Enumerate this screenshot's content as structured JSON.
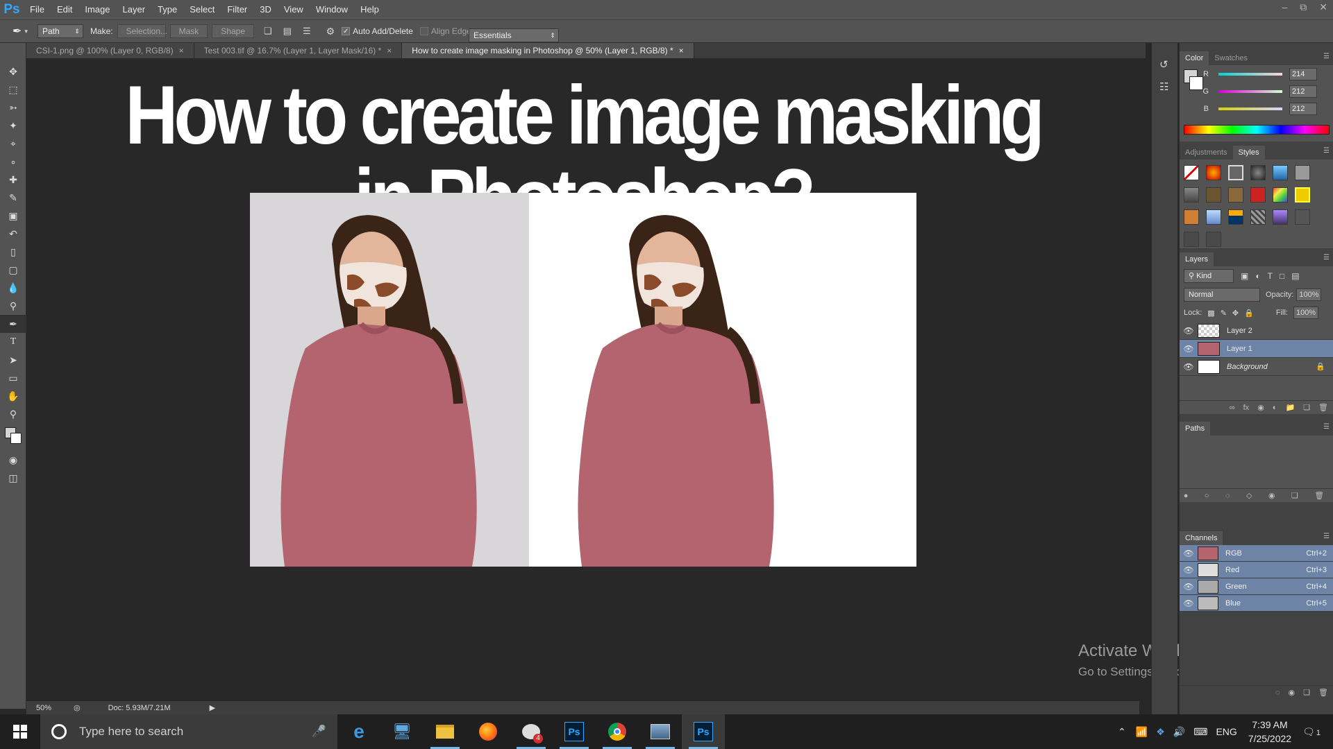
{
  "app": {
    "logo": "Ps"
  },
  "menu": [
    "File",
    "Edit",
    "Image",
    "Layer",
    "Type",
    "Select",
    "Filter",
    "3D",
    "View",
    "Window",
    "Help"
  ],
  "options": {
    "mode": "Path",
    "make_label": "Make:",
    "selection": "Selection...",
    "mask": "Mask",
    "shape": "Shape",
    "auto_add": "Auto Add/Delete",
    "align_edges": "Align Edges",
    "workspace": "Essentials"
  },
  "tabs": [
    {
      "label": "CSI-1.png @ 100% (Layer 0, RGB/8)",
      "close": "×"
    },
    {
      "label": "Test 003.tif @ 16.7% (Layer 1, Layer Mask/16) *",
      "close": "×"
    },
    {
      "label": "How to create image masking in Photoshop @ 50% (Layer 1, RGB/8) *",
      "close": "×"
    }
  ],
  "canvas": {
    "headline": "How to create image masking in Photoshop?"
  },
  "status": {
    "zoom": "50%",
    "doc": "Doc: 5.93M/7.21M"
  },
  "color_panel": {
    "tabs": [
      "Color",
      "Swatches"
    ],
    "r_label": "R",
    "g_label": "G",
    "b_label": "B",
    "r": "214",
    "g": "212",
    "b": "212",
    "fg_color": "#d6d4d4"
  },
  "styles_panel": {
    "tabs": [
      "Adjustments",
      "Styles"
    ]
  },
  "layers_panel": {
    "title": "Layers",
    "kind": "Kind",
    "blend": "Normal",
    "opacity_label": "Opacity:",
    "opacity": "100%",
    "lock_label": "Lock:",
    "fill_label": "Fill:",
    "fill": "100%",
    "layers": [
      {
        "name": "Layer 2"
      },
      {
        "name": "Layer 1"
      },
      {
        "name": "Background"
      }
    ]
  },
  "paths_panel": {
    "title": "Paths"
  },
  "channels_panel": {
    "title": "Channels",
    "channels": [
      {
        "name": "RGB",
        "shortcut": "Ctrl+2"
      },
      {
        "name": "Red",
        "shortcut": "Ctrl+3"
      },
      {
        "name": "Green",
        "shortcut": "Ctrl+4"
      },
      {
        "name": "Blue",
        "shortcut": "Ctrl+5"
      }
    ]
  },
  "watermark": {
    "line1": "Activate Windows",
    "line2": "Go to Settings to activate Windows."
  },
  "taskbar": {
    "search_placeholder": "Type here to search",
    "mail_badge": "4",
    "lang": "ENG",
    "time": "7:39 AM",
    "date": "7/25/2022",
    "notif_count": "1"
  }
}
